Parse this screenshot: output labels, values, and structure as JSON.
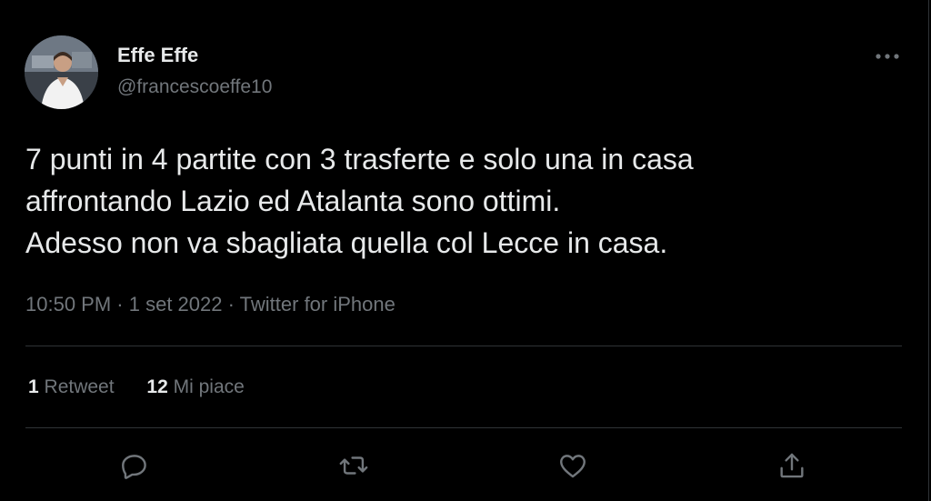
{
  "author": {
    "display_name": "Effe Effe",
    "handle": "@francescoeffe10",
    "avatar_icon": "user-avatar"
  },
  "tweet": {
    "text": "7 punti in 4 partite con 3 trasferte e solo una in casa\naffrontando Lazio ed Atalanta sono ottimi.\nAdesso non va sbagliata quella col Lecce in casa.",
    "time": "10:50 PM",
    "date": "1 set 2022",
    "source": "Twitter for iPhone",
    "separator": "·"
  },
  "stats": {
    "retweets_count": "1",
    "retweets_label": "Retweet",
    "likes_count": "12",
    "likes_label": "Mi piace"
  },
  "actions": {
    "reply_icon": "reply-icon",
    "retweet_icon": "retweet-icon",
    "like_icon": "heart-icon",
    "share_icon": "share-icon",
    "more_icon": "more-icon"
  },
  "colors": {
    "background": "#000000",
    "primary_text": "#e7e9ea",
    "secondary_text": "#71767b",
    "divider": "#2f3336"
  }
}
